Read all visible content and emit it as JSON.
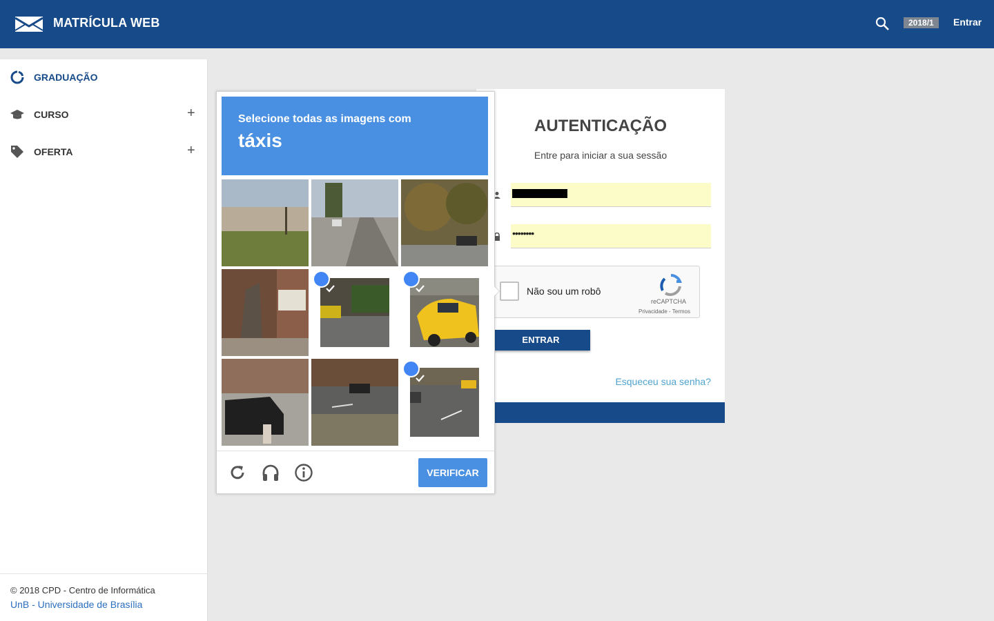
{
  "header": {
    "app_title": "MATRÍCULA WEB",
    "term_badge": "2018/1",
    "login_link": "Entrar",
    "bar_color": "#174a88"
  },
  "sidebar": {
    "items": [
      {
        "label": "GRADUAÇÃO",
        "icon": "circle-notch-icon",
        "active": true,
        "expandable": false
      },
      {
        "label": "CURSO",
        "icon": "graduation-cap-icon",
        "active": false,
        "expandable": true
      },
      {
        "label": "OFERTA",
        "icon": "tag-icon",
        "active": false,
        "expandable": true
      }
    ],
    "expand_symbol": "+",
    "footer": {
      "copyright": "© 2018 CPD - Centro de Informática",
      "university": "UnB - Universidade de Brasília"
    }
  },
  "login": {
    "title": "AUTENTICAÇÃO",
    "subtitle": "Entre para iniciar a sua sessão",
    "password_value": "••••••••",
    "captcha_checkbox_label": "Não sou um robô",
    "recaptcha_brand": "reCAPTCHA",
    "recaptcha_terms": "Privacidade - Termos",
    "submit_label": "ENTRAR",
    "forgot_link": "Esqueceu sua senha?"
  },
  "captcha_challenge": {
    "prompt": "Selecione todas as imagens com",
    "target": "táxis",
    "tiles": [
      {
        "scene": "grass-wall",
        "selected": false
      },
      {
        "scene": "suburban-street",
        "selected": false
      },
      {
        "scene": "trees-parking",
        "selected": false
      },
      {
        "scene": "statue-storefront",
        "selected": false
      },
      {
        "scene": "taxi-parked",
        "selected": true
      },
      {
        "scene": "yellow-taxi-closeup",
        "selected": true
      },
      {
        "scene": "van-street",
        "selected": false
      },
      {
        "scene": "highway-car",
        "selected": false
      },
      {
        "scene": "highway-taxi",
        "selected": true
      }
    ],
    "verify_label": "VERIFICAR",
    "footer_icons": [
      "reload-icon",
      "headphones-icon",
      "info-icon"
    ],
    "accent_color": "#4a90e2"
  }
}
